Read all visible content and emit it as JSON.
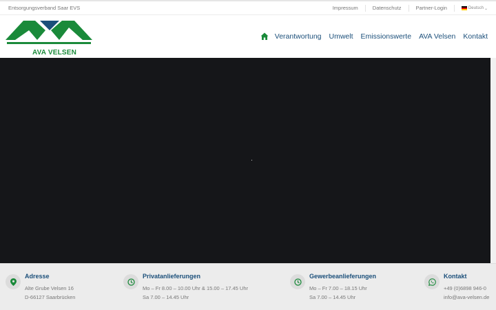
{
  "topbar": {
    "org": "Entsorgungsverband Saar EVS",
    "links": [
      "Impressum",
      "Datenschutz",
      "Partner-Login"
    ],
    "language": "Deutsch"
  },
  "header": {
    "logo_text": "AVA VELSEN",
    "nav": [
      "Verantwortung",
      "Umwelt",
      "Emissionswerte",
      "AVA Velsen",
      "Kontakt"
    ]
  },
  "footer": {
    "address": {
      "title": "Adresse",
      "line1": "Alte Grube Velsen 16",
      "line2": "D-66127 Saarbrücken"
    },
    "private": {
      "title": "Privatanlieferungen",
      "line1": "Mo – Fr 8.00 – 10.00 Uhr & 15.00 – 17.45 Uhr",
      "line2": "Sa 7.00 – 14.45 Uhr"
    },
    "commercial": {
      "title": "Gewerbeanlieferungen",
      "line1": "Mo – Fr 7.00 – 18.15 Uhr",
      "line2": "Sa 7.00 – 14.45 Uhr"
    },
    "contact": {
      "title": "Kontakt",
      "line1": "+49 (0)6898 946-0",
      "line2": "info@ava-velsen.de"
    }
  },
  "colors": {
    "brand_green": "#1a8a3a",
    "brand_blue": "#1b4f7a",
    "hero_bg": "#151619",
    "footer_bg": "#ececec"
  }
}
